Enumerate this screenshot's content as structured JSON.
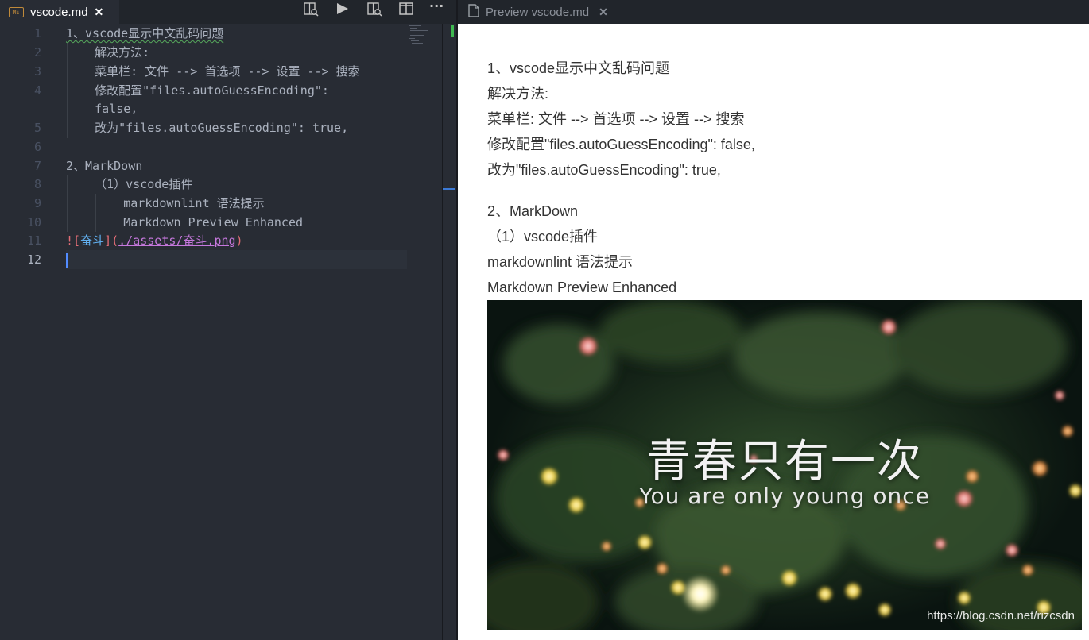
{
  "editor": {
    "tab": {
      "badge": "M↓",
      "title": "vscode.md",
      "close": "✕"
    },
    "toolbar_icons": [
      "open-preview-side-icon",
      "run-icon",
      "open-preview-icon",
      "split-editor-icon",
      "more-actions-icon"
    ],
    "toolbar_more": "···",
    "line_numbers": [
      "1",
      "2",
      "3",
      "4",
      "5",
      "6",
      "7",
      "8",
      "9",
      "10",
      "11",
      "12"
    ],
    "active_line": "12",
    "lines": {
      "l1": "1、vscode显示中文乱码问题",
      "l2": "    解决方法:",
      "l3": "    菜单栏: 文件 --> 首选项 --> 设置 --> 搜索",
      "l4a": "    修改配置\"files.autoGuessEncoding\":",
      "l4b": "    false,",
      "l5": "    改为\"files.autoGuessEncoding\": true,",
      "l7": "2、MarkDown",
      "l8": "    （1）vscode插件",
      "l9": "        markdownlint 语法提示",
      "l10": "        Markdown Preview Enhanced",
      "l11_bang": "![",
      "l11_alt": "奋斗",
      "l11_mid": "](",
      "l11_url": "./assets/奋斗.png",
      "l11_end": ")"
    }
  },
  "preview": {
    "tab_title": "Preview vscode.md",
    "tab_close": "✕",
    "lines": [
      "1、vscode显示中文乱码问题",
      "解决方法:",
      "菜单栏: 文件 --> 首选项 --> 设置 --> 搜索",
      "修改配置\"files.autoGuessEncoding\": false,",
      "改为\"files.autoGuessEncoding\": true,",
      "2、MarkDown",
      "（1）vscode插件",
      "markdownlint 语法提示",
      "Markdown Preview Enhanced"
    ],
    "image": {
      "title": "青春只有一次",
      "subtitle": "You are only young once",
      "watermark": "https://blog.csdn.net/rizcsdn"
    }
  },
  "colors": {
    "editor_bg": "#282c34",
    "tabbar_bg": "#21252b",
    "line_number": "#495162",
    "text": "#abb2bf",
    "md_punct": "#e06c75",
    "md_alt": "#61afef",
    "md_url": "#c678dd",
    "cursor": "#528bff",
    "preview_bg": "#ffffff",
    "preview_text": "#333333"
  }
}
